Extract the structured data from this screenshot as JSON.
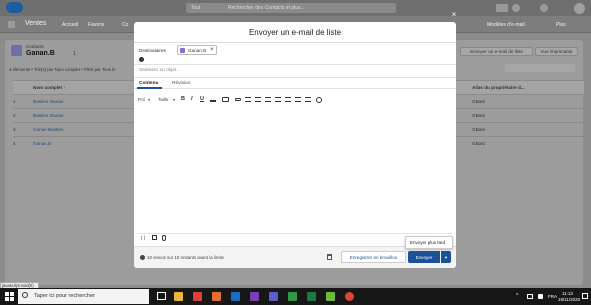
{
  "app": {
    "name": "Ventes",
    "search_scope": "Tout",
    "search_placeholder": "Rechercher des Contacts et plus...",
    "nav_items": [
      "Accueil",
      "Favoris",
      "Co"
    ],
    "nav_right_items": [
      "Modèles d'e-mail",
      "Plus"
    ]
  },
  "list": {
    "object_label": "Contacts",
    "title": "Ganan.B",
    "pin_count": "1",
    "summary": "4 éléments • Trié(s) par Nom complet • Filtré par Tous le",
    "buttons": [
      "Envoyer un e-mail de liste",
      "Vue imprimable"
    ],
    "columns": [
      "Nom complet ↑",
      "Alias du propriétaire d..."
    ],
    "rows": [
      {
        "num": "1",
        "name": "Bastien Ganan",
        "alias": "GBast"
      },
      {
        "num": "2",
        "name": "Bastien Ganan",
        "alias": "GBast"
      },
      {
        "num": "3",
        "name": "Ganan Bastien",
        "alias": "GBast"
      },
      {
        "num": "4",
        "name": "Ganan.B",
        "alias": "GBast"
      }
    ]
  },
  "modal": {
    "title": "Envoyer un e-mail de liste",
    "recipients_label": "Destinataires",
    "recipient_chip": "Ganan.B",
    "subject_placeholder": "Saisissez un objet...",
    "tabs": [
      "Contenu",
      "Révision"
    ],
    "font_select": "Pol",
    "size_select": "Taille",
    "footer_note": "10 envois sur 10 restants avant la limite",
    "save_draft": "Enregistrer en brouillon",
    "send": "Envoyer",
    "send_later": "Envoyer plus tard"
  },
  "status_link": "javascript:void(0)",
  "taskbar": {
    "search_placeholder": "Taper ici pour rechercher",
    "language": "FRA",
    "time": "11:13",
    "date": "19/11/2020"
  },
  "colors": {
    "brand_blue": "#1b5297",
    "link_blue": "#0b5cab",
    "overlay": "#7d7d7d"
  }
}
